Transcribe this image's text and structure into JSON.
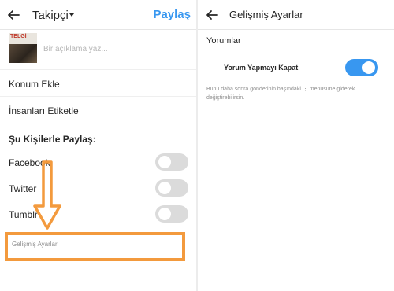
{
  "left": {
    "header": {
      "title": "Takipçi",
      "share_label": "Paylaş"
    },
    "caption": {
      "placeholder": "Bir açıklama yaz...",
      "thumb_logo": "TELGİ"
    },
    "rows": {
      "location": "Konum Ekle",
      "tag_people": "İnsanları Etiketle"
    },
    "share_section": {
      "title": "Şu Kişilerle Paylaş:",
      "items": [
        {
          "label": "Facebook",
          "on": false
        },
        {
          "label": "Twitter",
          "on": false
        },
        {
          "label": "Tumblr",
          "on": false
        }
      ]
    },
    "advanced": {
      "label": "Gelişmiş Ayarlar"
    }
  },
  "right": {
    "header": {
      "title": "Gelişmiş Ayarlar"
    },
    "section": "Yorumlar",
    "comment_toggle": {
      "label": "Yorum Yapmayı Kapat",
      "on": true
    },
    "description": "Bunu daha sonra gönderinin başındaki ⋮ menüsüne giderek değiştirebilirsin."
  },
  "colors": {
    "accent": "#3897f0",
    "highlight": "#f39a3d",
    "toggle_off": "#dbdbdb"
  },
  "icons": {
    "back": "arrow-left-icon",
    "caret": "chevron-down-icon",
    "annotation": "down-arrow-icon"
  }
}
